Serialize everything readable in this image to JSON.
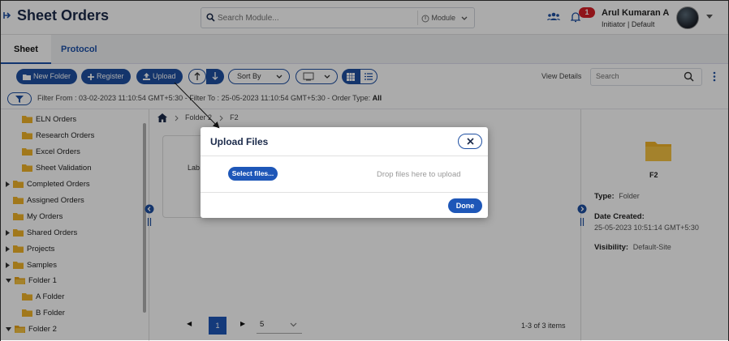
{
  "app": {
    "title": "Sheet Orders"
  },
  "search": {
    "placeholder": "Search Module...",
    "module_label": "Module"
  },
  "notifications": {
    "count": "1"
  },
  "user": {
    "name": "Arul Kumaran A",
    "role": "Initiator | Default"
  },
  "tabs": [
    {
      "label": "Sheet",
      "active": true
    },
    {
      "label": "Protocol",
      "active": false
    }
  ],
  "toolbar": {
    "new_folder": "New Folder",
    "register": "Register",
    "upload": "Upload",
    "sort_by": "Sort By",
    "view_details": "View Details",
    "search_placeholder": "Search"
  },
  "filter": {
    "from_label": "Filter From :",
    "from_value": "03-02-2023 11:10:54 GMT+5:30",
    "to_label": "- Filter To :",
    "to_value": "25-05-2023 11:10:54 GMT+5:30",
    "type_label": "- Order Type:",
    "type_value": "All"
  },
  "sidebar": {
    "items": [
      {
        "label": "ELN Orders"
      },
      {
        "label": "Research Orders"
      },
      {
        "label": "Excel Orders"
      },
      {
        "label": "Sheet Validation"
      },
      {
        "label": "Completed Orders"
      },
      {
        "label": "Assigned Orders"
      },
      {
        "label": "My Orders"
      },
      {
        "label": "Shared Orders"
      },
      {
        "label": "Projects"
      },
      {
        "label": "Samples"
      },
      {
        "label": "Folder 1"
      },
      {
        "label": "A Folder"
      },
      {
        "label": "B Folder"
      },
      {
        "label": "Folder 2"
      }
    ]
  },
  "breadcrumb": {
    "items": [
      "Folder 2",
      "F2"
    ]
  },
  "card": {
    "label": "Lab"
  },
  "pager": {
    "current": "1",
    "page_size": "5",
    "items_count": "1-3 of 3 items"
  },
  "details": {
    "name": "F2",
    "type_label": "Type:",
    "type_value": "Folder",
    "created_label": "Date Created:",
    "created_value": "25-05-2023 10:51:14 GMT+5:30",
    "visibility_label": "Visibility:",
    "visibility_value": "Default-Site"
  },
  "modal": {
    "title": "Upload Files",
    "select_files": "Select files...",
    "drop_text": "Drop files here to upload",
    "done": "Done"
  },
  "colors": {
    "primary": "#1e4fa2",
    "badge": "#d61f26",
    "folder": "#f0b429"
  }
}
